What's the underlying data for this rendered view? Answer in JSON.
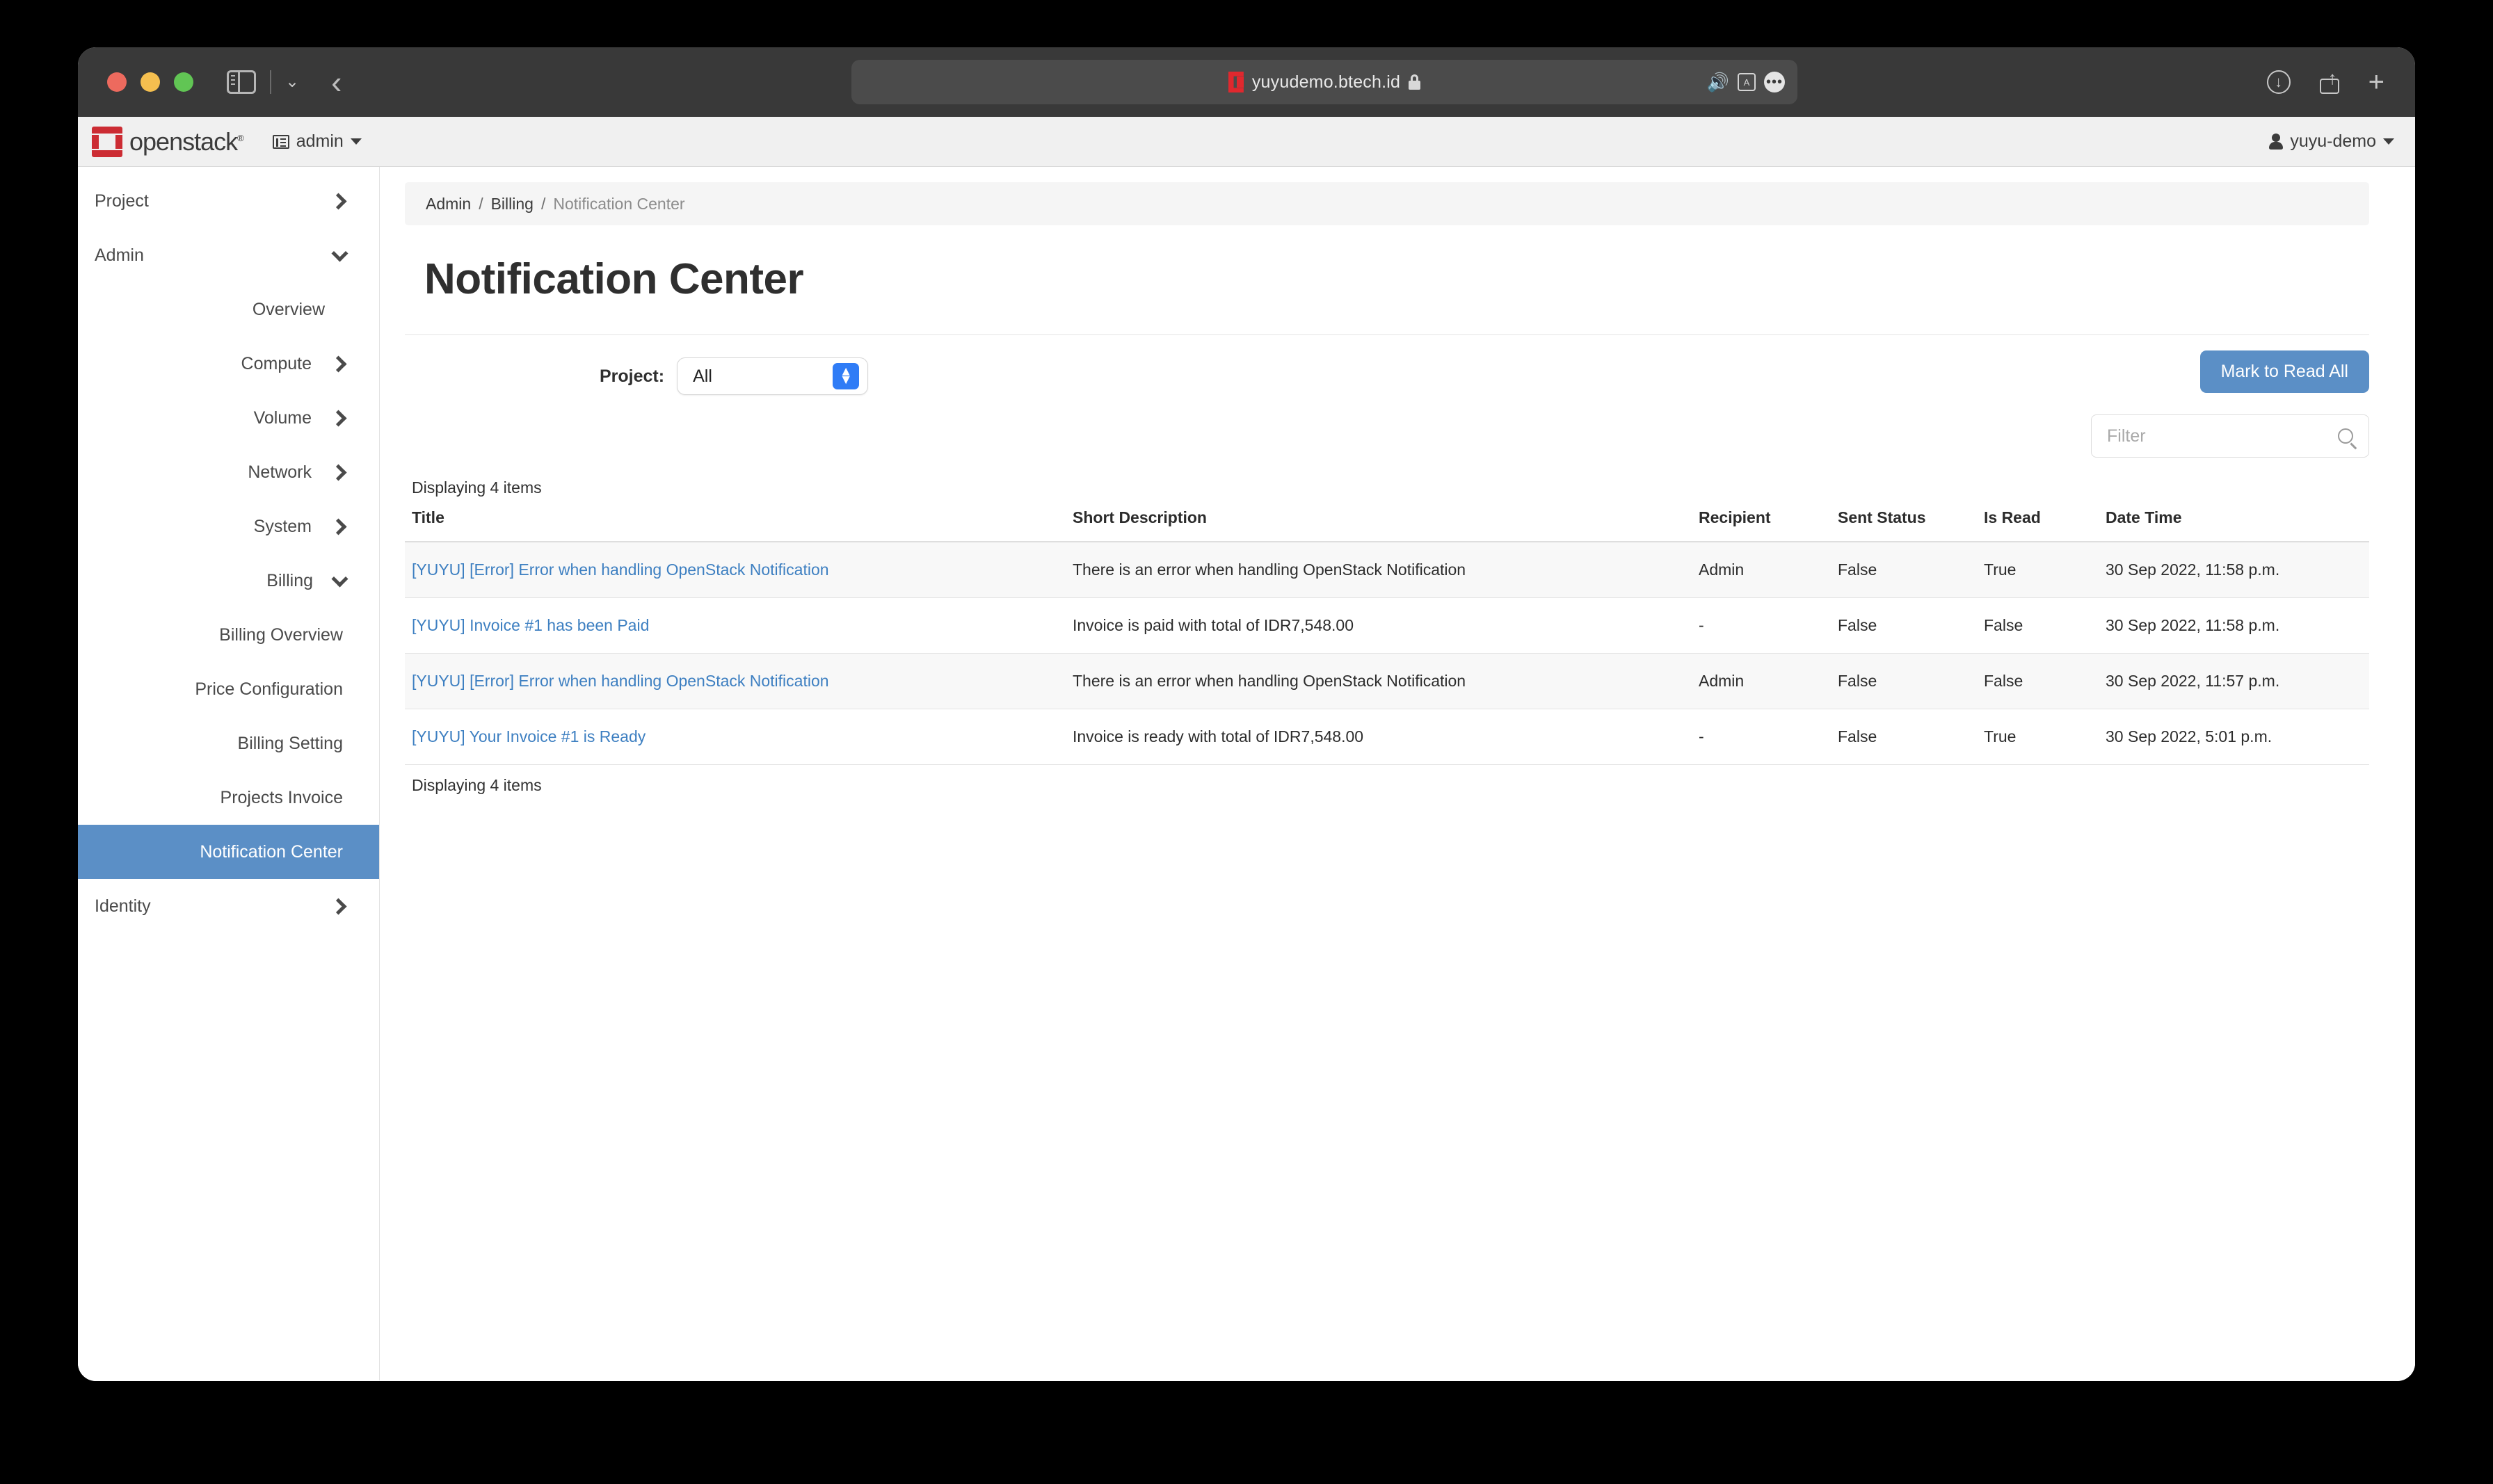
{
  "browser": {
    "url": "yuyudemo.btech.id",
    "icons": {
      "sidebar_toggle": "sidebar-toggle-icon",
      "tab_overview": "chevron-down-icon",
      "back": "back-chevron-icon",
      "favicon": "site-favicon",
      "lock": "lock-icon",
      "speaker": "speaker-icon",
      "translate": "translate-icon",
      "more": "more-options-icon",
      "download": "download-icon",
      "share": "share-icon",
      "new_tab": "plus-icon"
    },
    "speaker_glyph": "🔊",
    "translate_glyph": "A",
    "more_glyph": "•••",
    "plus_glyph": "+",
    "back_glyph": "‹",
    "chevron_glyph": "⌄"
  },
  "navbar": {
    "brand": "openstack",
    "brand_mark_color": "#cc2c33",
    "brand_registered": "®",
    "project_switch": "admin",
    "user": "yuyu-demo"
  },
  "sidebar": {
    "items": [
      {
        "label": "Project",
        "level": 1,
        "chevron": "right",
        "active": false
      },
      {
        "label": "Admin",
        "level": 1,
        "chevron": "down",
        "active": false
      },
      {
        "label": "Overview",
        "level": 2,
        "chevron": "none",
        "active": false
      },
      {
        "label": "Compute",
        "level": 2,
        "chevron": "right",
        "active": false
      },
      {
        "label": "Volume",
        "level": 2,
        "chevron": "right",
        "active": false
      },
      {
        "label": "Network",
        "level": 2,
        "chevron": "right",
        "active": false
      },
      {
        "label": "System",
        "level": 2,
        "chevron": "right",
        "active": false
      },
      {
        "label": "Billing",
        "level": 2,
        "chevron": "down",
        "active": false
      },
      {
        "label": "Billing Overview",
        "level": 3,
        "chevron": "none",
        "active": false
      },
      {
        "label": "Price Configuration",
        "level": 3,
        "chevron": "none",
        "active": false
      },
      {
        "label": "Billing Setting",
        "level": 3,
        "chevron": "none",
        "active": false
      },
      {
        "label": "Projects Invoice",
        "level": 3,
        "chevron": "none",
        "active": false
      },
      {
        "label": "Notification Center",
        "level": 3,
        "chevron": "none",
        "active": true
      },
      {
        "label": "Identity",
        "level": 1,
        "chevron": "right",
        "active": false
      }
    ],
    "active_bg": "#5b8fc6"
  },
  "breadcrumb": {
    "items": [
      "Admin",
      "Billing",
      "Notification Center"
    ],
    "separator": "/"
  },
  "page": {
    "title": "Notification Center"
  },
  "toolbar": {
    "project_label": "Project:",
    "project_value": "All",
    "mark_read_label": "Mark to Read All",
    "mark_read_color": "#5b8fc6"
  },
  "filter": {
    "placeholder": "Filter",
    "value": ""
  },
  "table": {
    "count_top": "Displaying 4 items",
    "count_bottom": "Displaying 4 items",
    "headers": [
      "Title",
      "Short Description",
      "Recipient",
      "Sent Status",
      "Is Read",
      "Date Time"
    ],
    "rows": [
      {
        "title": "[YUYU] [Error] Error when handling OpenStack Notification",
        "description": "There is an error when handling OpenStack Notification",
        "recipient": "Admin",
        "sent_status": "False",
        "is_read": "True",
        "date_time": "30 Sep 2022, 11:58 p.m."
      },
      {
        "title": "[YUYU] Invoice #1 has been Paid",
        "description": "Invoice is paid with total of IDR7,548.00",
        "recipient": "-",
        "sent_status": "False",
        "is_read": "False",
        "date_time": "30 Sep 2022, 11:58 p.m."
      },
      {
        "title": "[YUYU] [Error] Error when handling OpenStack Notification",
        "description": "There is an error when handling OpenStack Notification",
        "recipient": "Admin",
        "sent_status": "False",
        "is_read": "False",
        "date_time": "30 Sep 2022, 11:57 p.m."
      },
      {
        "title": "[YUYU] Your Invoice #1 is Ready",
        "description": "Invoice is ready with total of IDR7,548.00",
        "recipient": "-",
        "sent_status": "False",
        "is_read": "True",
        "date_time": "30 Sep 2022, 5:01 p.m."
      }
    ]
  }
}
